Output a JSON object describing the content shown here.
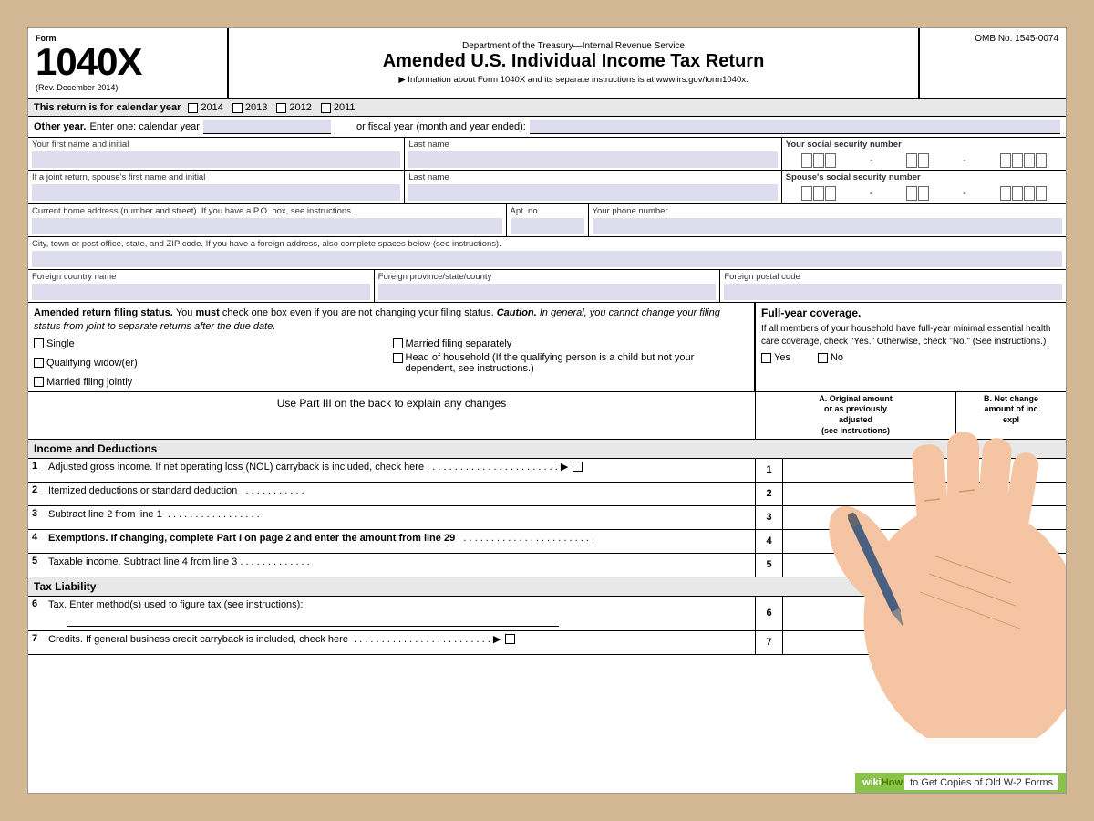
{
  "page": {
    "background_color": "#d4b896",
    "title": "Form 1040X - Amended U.S. Individual Income Tax Return"
  },
  "form": {
    "form_label": "Form",
    "form_number": "1040X",
    "rev_date": "(Rev. December 2014)",
    "dept_line": "Department of the Treasury—Internal Revenue Service",
    "main_title": "Amended U.S. Individual Income Tax Return",
    "info_line": "▶ Information about Form 1040X and its separate instructions is at www.irs.gov/form1040x.",
    "omb_number": "OMB No. 1545-0074",
    "calendar_year_label": "This return is for calendar year",
    "year_2014": "2014",
    "year_2013": "2013",
    "year_2012": "2012",
    "year_2011": "2011",
    "other_year_label": "Other year.",
    "other_year_text": "Enter one: calendar year",
    "or_text": "or fiscal year (month and year ended):",
    "first_name_label": "Your first name and initial",
    "last_name_label": "Last name",
    "ssn_label": "Your social security number",
    "spouse_first_name_label": "If a joint return, spouse's first name and initial",
    "spouse_last_name_label": "Last name",
    "spouse_ssn_label": "Spouse's social security number",
    "address_label": "Current home address (number and street). If you have a P.O. box, see instructions.",
    "apt_label": "Apt. no.",
    "phone_label": "Your phone number",
    "city_label": "City, town or post office, state, and ZIP code.  If you have a foreign address, also complete spaces below (see instructions).",
    "foreign_country_label": "Foreign country name",
    "foreign_province_label": "Foreign province/state/county",
    "foreign_postal_label": "Foreign postal code",
    "filing_status_text": "Amended return filing status.",
    "filing_status_must": "You must",
    "filing_status_cont": "check one box even if you are not changing your filing status.",
    "filing_caution_label": "Caution.",
    "filing_caution_text": "In general, you cannot change your filing status from joint to separate returns after the due date.",
    "single_label": "Single",
    "qualifying_widow_label": "Qualifying widow(er)",
    "married_jointly_label": "Married filing jointly",
    "married_separately_label": "Married filing separately",
    "head_household_label": "Head of household (If the qualifying person is a child but not your dependent, see instructions.)",
    "coverage_title": "Full-year coverage.",
    "coverage_text": "If all members of your household have full-year minimal essential health care coverage, check \"Yes.\" Otherwise, check \"No.\" (See instructions.)",
    "yes_label": "Yes",
    "no_label": "No",
    "part_iii_text": "Use Part III on the back to explain any changes",
    "col_a_header": "A. Original amount\nor as previously\nadjusted\n(see instructions)",
    "col_b_header": "B. Net change\namount of inc\nexpl",
    "income_title": "Income and Deductions",
    "row1_num": "1",
    "row1_text": "Adjusted gross income. If net operating loss (NOL) carryback is included, check here",
    "row1_dots": ". . . . . . . . . . . . . . . . . . . . . . . .",
    "row1_arrow": "▶",
    "row2_num": "2",
    "row2_text": "Itemized deductions or standard deduction",
    "row2_dots": " . . . . . . . . . . .",
    "row3_num": "3",
    "row3_text": "Subtract line 2 from line 1",
    "row3_dots": ". . . . . . . . . . . . . . . . .",
    "row4_num": "4",
    "row4_text_bold": "Exemptions. If changing, complete Part I on page 2 and enter the amount from line 29",
    "row4_dots": " . . . . . . . . . . . . . . . . . . . . . . . .",
    "row5_num": "5",
    "row5_text": "Taxable income. Subtract line 4 from line 3 . . . . . . . . . . . . .",
    "tax_liability_title": "Tax Liability",
    "row6_num": "6",
    "row6_text": "Tax. Enter method(s) used to figure tax (see instructions):",
    "row7_num": "7",
    "row7_text": "Credits. If general business credit carryback is included, check here",
    "row7_dots": ". . . . . . . . . . . . . . . . . . . . . . . . . .",
    "row7_arrow": "▶",
    "wikihow_wiki": "wiki",
    "wikihow_how": "How",
    "wikihow_text": "to Get Copies of Old W-2 Forms"
  }
}
